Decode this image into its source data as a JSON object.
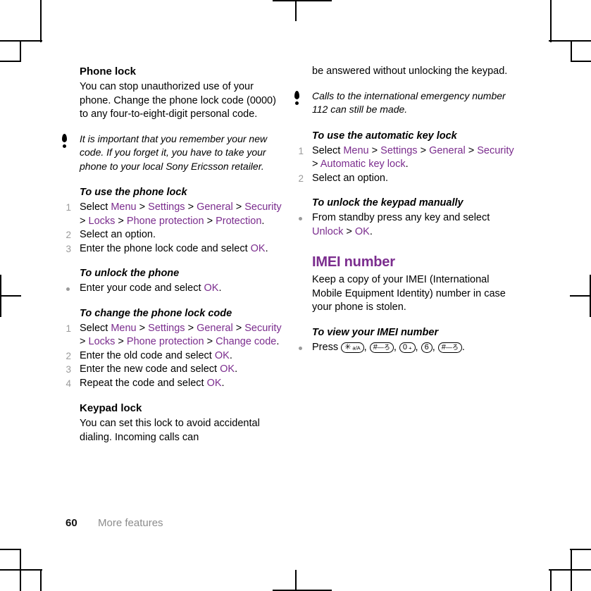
{
  "document": {
    "page_number": "60",
    "section_name": "More features",
    "accent_color": "#7B2D8E",
    "step_number_color": "#9a9a9a"
  },
  "left_column": {
    "phone_lock": {
      "heading": "Phone lock",
      "body": "You can stop unauthorized use of your phone. Change the phone lock code (0000) to any four-to-eight-digit personal code.",
      "note_icon": "exclamation-icon",
      "note": "It is important that you remember your new code. If you forget it, you have to take your phone to your local Sony Ericsson retailer."
    },
    "use_phone_lock": {
      "heading": "To use the phone lock",
      "steps": [
        {
          "parts": [
            {
              "t": "Select ",
              "ui": false
            },
            {
              "t": "Menu",
              "ui": true
            },
            {
              "t": " > ",
              "ui": false
            },
            {
              "t": "Settings",
              "ui": true
            },
            {
              "t": " > ",
              "ui": false
            },
            {
              "t": "General",
              "ui": true
            },
            {
              "t": " > ",
              "ui": false
            },
            {
              "t": "Security",
              "ui": true
            },
            {
              "t": " > ",
              "ui": false
            },
            {
              "t": "Locks",
              "ui": true
            },
            {
              "t": " > ",
              "ui": false
            },
            {
              "t": "Phone protection",
              "ui": true
            },
            {
              "t": " > ",
              "ui": false
            },
            {
              "t": "Protection",
              "ui": true
            },
            {
              "t": ".",
              "ui": false
            }
          ]
        },
        {
          "parts": [
            {
              "t": "Select an option.",
              "ui": false
            }
          ]
        },
        {
          "parts": [
            {
              "t": "Enter the phone lock code and select ",
              "ui": false
            },
            {
              "t": "OK",
              "ui": true
            },
            {
              "t": ".",
              "ui": false
            }
          ]
        }
      ]
    },
    "unlock_phone": {
      "heading": "To unlock the phone",
      "bullets": [
        {
          "parts": [
            {
              "t": "Enter your code and select ",
              "ui": false
            },
            {
              "t": "OK",
              "ui": true
            },
            {
              "t": ".",
              "ui": false
            }
          ]
        }
      ]
    },
    "change_phone_lock_code": {
      "heading": "To change the phone lock code",
      "steps": [
        {
          "parts": [
            {
              "t": "Select ",
              "ui": false
            },
            {
              "t": "Menu",
              "ui": true
            },
            {
              "t": " > ",
              "ui": false
            },
            {
              "t": "Settings",
              "ui": true
            },
            {
              "t": " > ",
              "ui": false
            },
            {
              "t": "General",
              "ui": true
            },
            {
              "t": " > ",
              "ui": false
            },
            {
              "t": "Security",
              "ui": true
            },
            {
              "t": " > ",
              "ui": false
            },
            {
              "t": "Locks",
              "ui": true
            },
            {
              "t": " > ",
              "ui": false
            },
            {
              "t": "Phone protection",
              "ui": true
            },
            {
              "t": " > ",
              "ui": false
            },
            {
              "t": "Change code",
              "ui": true
            },
            {
              "t": ".",
              "ui": false
            }
          ]
        },
        {
          "parts": [
            {
              "t": "Enter the old code and select ",
              "ui": false
            },
            {
              "t": "OK",
              "ui": true
            },
            {
              "t": ".",
              "ui": false
            }
          ]
        },
        {
          "parts": [
            {
              "t": "Enter the new code and select ",
              "ui": false
            },
            {
              "t": "OK",
              "ui": true
            },
            {
              "t": ".",
              "ui": false
            }
          ]
        },
        {
          "parts": [
            {
              "t": "Repeat the code and select ",
              "ui": false
            },
            {
              "t": "OK",
              "ui": true
            },
            {
              "t": ".",
              "ui": false
            }
          ]
        }
      ]
    },
    "keypad_lock": {
      "heading": "Keypad lock",
      "body": "You can set this lock to avoid accidental dialing. Incoming calls can"
    }
  },
  "right_column": {
    "keypad_lock_cont": {
      "body": "be answered without unlocking the keypad.",
      "note_icon": "exclamation-icon",
      "note": "Calls to the international emergency number 112 can still be made."
    },
    "automatic_key_lock": {
      "heading": "To use the automatic key lock",
      "steps": [
        {
          "parts": [
            {
              "t": "Select ",
              "ui": false
            },
            {
              "t": "Menu",
              "ui": true
            },
            {
              "t": " > ",
              "ui": false
            },
            {
              "t": "Settings",
              "ui": true
            },
            {
              "t": " > ",
              "ui": false
            },
            {
              "t": "General",
              "ui": true
            },
            {
              "t": " > ",
              "ui": false
            },
            {
              "t": "Security",
              "ui": true
            },
            {
              "t": " > ",
              "ui": false
            },
            {
              "t": "Automatic key lock",
              "ui": true
            },
            {
              "t": ".",
              "ui": false
            }
          ]
        },
        {
          "parts": [
            {
              "t": "Select an option.",
              "ui": false
            }
          ]
        }
      ]
    },
    "unlock_keypad_manually": {
      "heading": "To unlock the keypad manually",
      "bullets": [
        {
          "parts": [
            {
              "t": "From standby press any key and select ",
              "ui": false
            },
            {
              "t": "Unlock",
              "ui": true
            },
            {
              "t": " > ",
              "ui": false
            },
            {
              "t": "OK",
              "ui": true
            },
            {
              "t": ".",
              "ui": false
            }
          ]
        }
      ]
    },
    "imei_number": {
      "heading": "IMEI number",
      "body": "Keep a copy of your IMEI (International Mobile Equipment Identity) number in case your phone is stolen."
    },
    "view_imei": {
      "heading": "To view your IMEI number",
      "bullet_prefix": "Press ",
      "keys": [
        {
          "name": "star-key",
          "main": "✳",
          "sub": "a/A"
        },
        {
          "name": "hash-key",
          "main": "#",
          "sub": "―ろ"
        },
        {
          "name": "zero-key",
          "main": "0",
          "sub": "+"
        },
        {
          "name": "six-key",
          "main": "6",
          "sub": ""
        },
        {
          "name": "hash-key",
          "main": "#",
          "sub": "―ろ"
        }
      ],
      "separator": ", ",
      "terminator": "."
    }
  }
}
